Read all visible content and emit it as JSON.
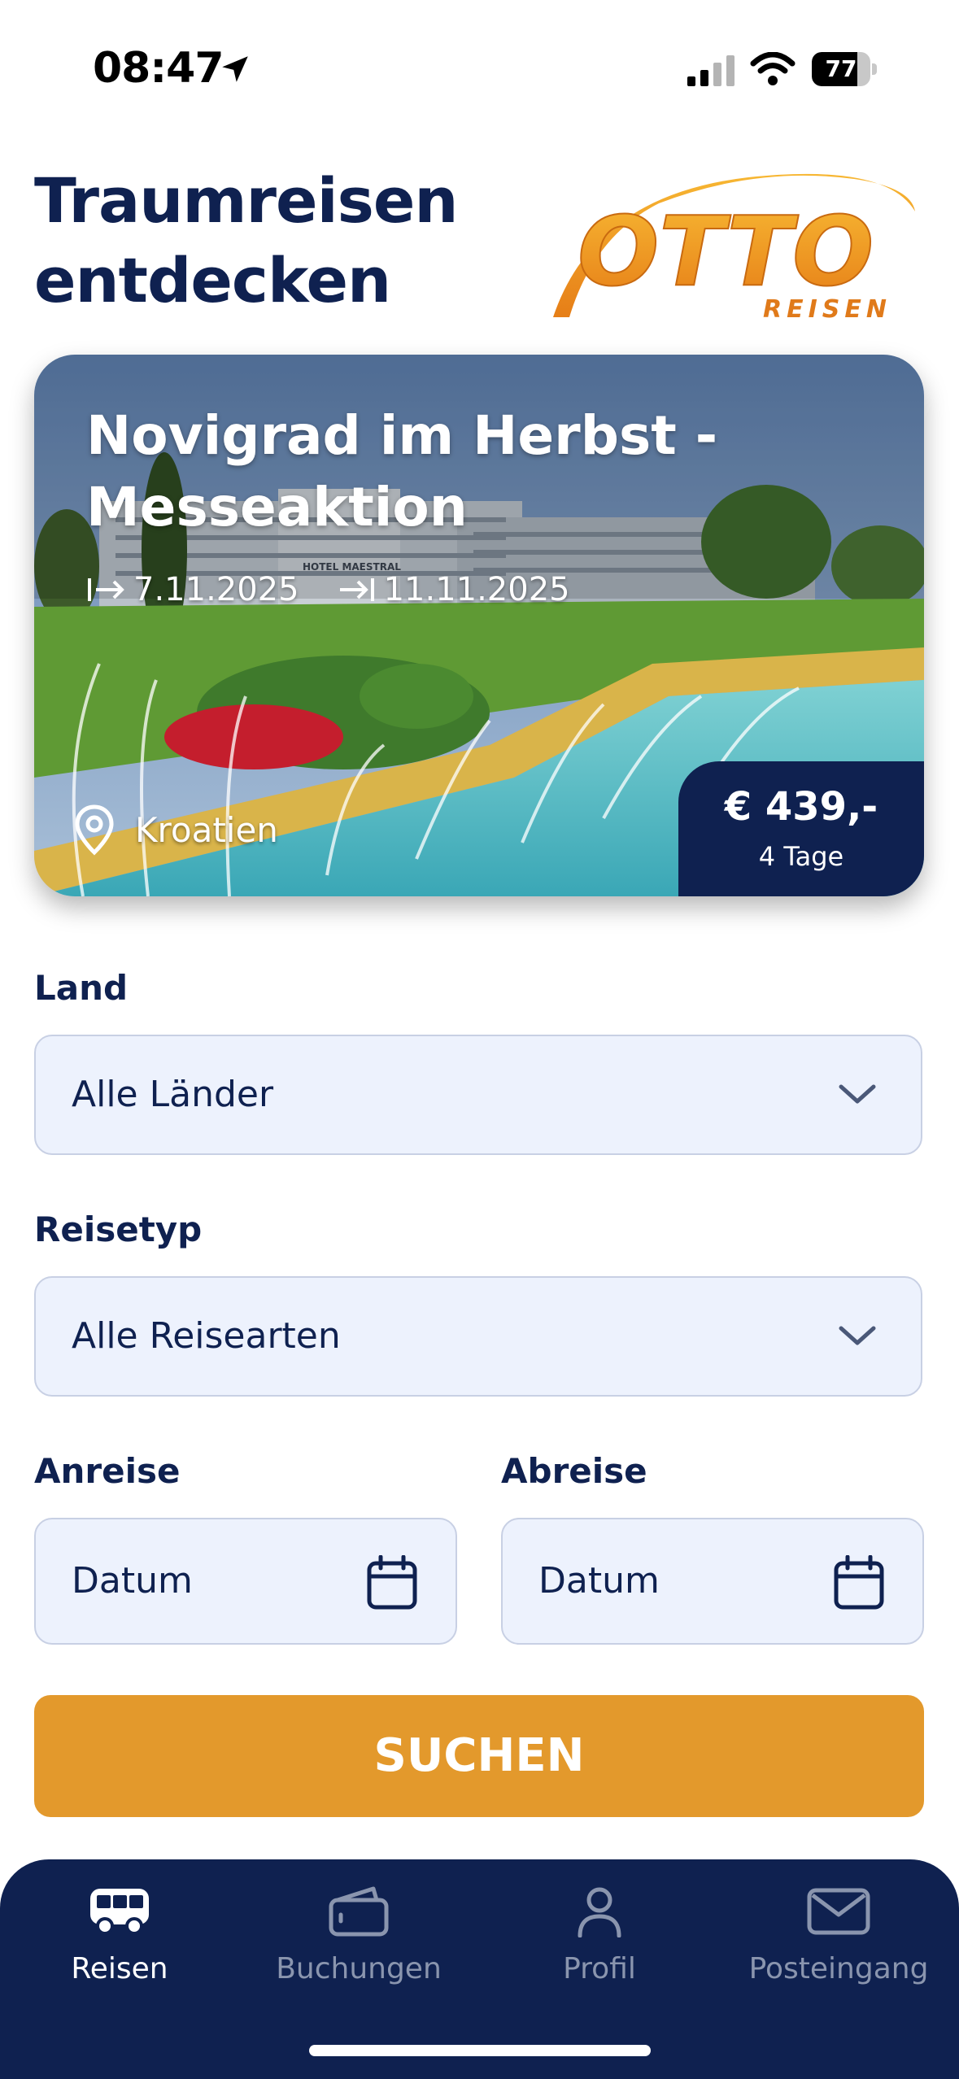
{
  "status_bar": {
    "time": "08:47",
    "battery": "77",
    "battery_level": 0.77
  },
  "header": {
    "title_line1": "Traumreisen",
    "title_line2": "entdecken",
    "logo_text": "OTTO",
    "logo_subtext": "REISEN"
  },
  "featured": {
    "title_line1": "Novigrad im Herbst -",
    "title_line2": "Messeaktion",
    "start_date": "7.11.2025",
    "end_date": "11.11.2025",
    "location": "Kroatien",
    "price": "€ 439,-",
    "duration": "4 Tage",
    "hotel_sign": "HOTEL MAESTRAL"
  },
  "form": {
    "land_label": "Land",
    "land_value": "Alle Länder",
    "type_label": "Reisetyp",
    "type_value": "Alle Reisearten",
    "arrival_label": "Anreise",
    "arrival_value": "Datum",
    "departure_label": "Abreise",
    "departure_value": "Datum",
    "search_label": "SUCHEN"
  },
  "tabs": [
    {
      "label": "Reisen",
      "icon": "bus-icon",
      "active": true
    },
    {
      "label": "Buchungen",
      "icon": "wallet-icon",
      "active": false
    },
    {
      "label": "Profil",
      "icon": "person-icon",
      "active": false
    },
    {
      "label": "Posteingang",
      "icon": "mail-icon",
      "active": false
    }
  ],
  "colors": {
    "navy": "#0f2150",
    "accent": "#e3992c",
    "field_bg": "#edf2fd"
  }
}
